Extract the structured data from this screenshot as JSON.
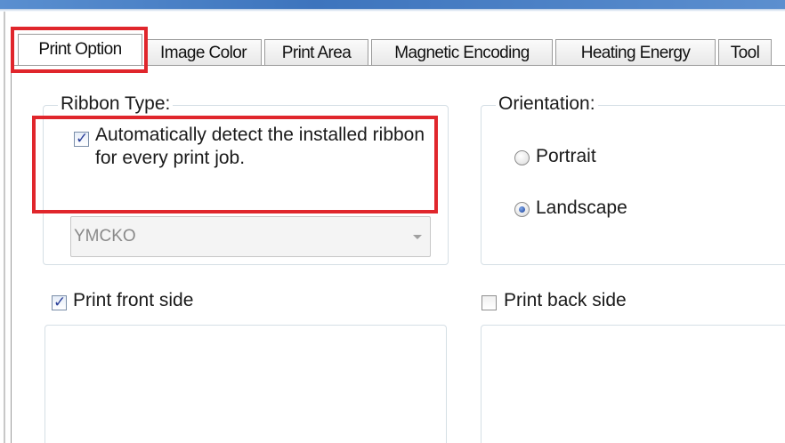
{
  "tabs": [
    {
      "label": "Print Option",
      "active": true
    },
    {
      "label": "Image Color",
      "active": false
    },
    {
      "label": "Print Area",
      "active": false
    },
    {
      "label": "Magnetic Encoding",
      "active": false
    },
    {
      "label": "Heating Energy",
      "active": false
    },
    {
      "label": "Tool",
      "active": false
    }
  ],
  "ribbon_type": {
    "legend": "Ribbon Type:",
    "auto_detect_label": "Automatically detect the installed ribbon for every print job.",
    "auto_detect_checked": true,
    "ribbon_select_value": "YMCKO",
    "ribbon_select_enabled": false
  },
  "orientation": {
    "legend": "Orientation:",
    "options": [
      {
        "label": "Portrait",
        "selected": false
      },
      {
        "label": "Landscape",
        "selected": true
      }
    ]
  },
  "print_front": {
    "label": "Print front side",
    "checked": true
  },
  "print_back": {
    "label": "Print back side",
    "checked": false
  },
  "icons": {
    "check": "checkmark-icon",
    "dropdown": "chevron-down-icon",
    "radio": "radio-dot-icon"
  },
  "colors": {
    "highlight": "#e0262c",
    "accent": "#2a3f99",
    "title_bar": "#3d74bd"
  }
}
